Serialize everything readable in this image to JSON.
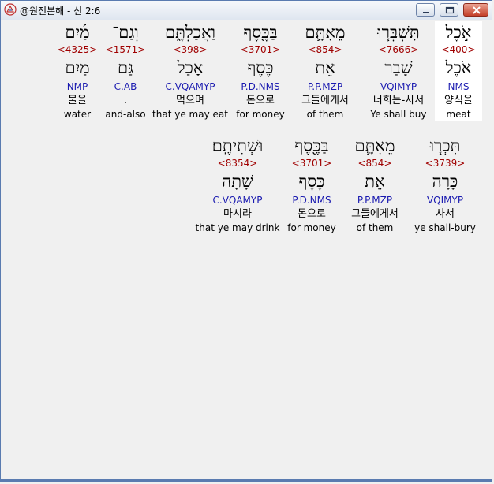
{
  "window": {
    "title": "@원전본해 - 신 2:6",
    "min_label": "minimize",
    "max_label": "maximize",
    "close_label": "close"
  },
  "rows": [
    {
      "words": [
        {
          "heb": "אֹ֣כֶל",
          "strong": "<400>",
          "lemma": "אֹכֶל",
          "morph": "NMS",
          "kor": "양식을",
          "eng": "meat",
          "highlight": true
        },
        {
          "heb": "תִּשְׁבְּר֧וּ",
          "strong": "<7666>",
          "lemma": "שָׁבַר",
          "morph": "VQIMYP",
          "kor": "너희는-사서",
          "eng": "Ye shall buy"
        },
        {
          "heb": "מֵאִתָּ֛ם",
          "strong": "<854>",
          "lemma": "אֵת",
          "morph": "P.P.MZP",
          "kor": "그들에게서",
          "eng": "of them"
        },
        {
          "heb": "בַּכֶּ֖סֶף",
          "strong": "<3701>",
          "lemma": "כֶּסֶף",
          "morph": "P.D.NMS",
          "kor": "돈으로",
          "eng": "for money"
        },
        {
          "heb": "וַאֲכַלְתֶּ֑ם",
          "strong": "<398>",
          "lemma": "אָכַל",
          "morph": "C.VQAMYP",
          "kor": "먹으며",
          "eng": "that ye may eat"
        },
        {
          "heb": "וְגַם־",
          "strong": "<1571>",
          "lemma": "גַּם",
          "morph": "C.AB",
          "kor": ".",
          "eng": "and-also"
        },
        {
          "heb": "מַ֜יִם",
          "strong": "<4325>",
          "lemma": "מַיִם",
          "morph": "NMP",
          "kor": "물을",
          "eng": "water"
        }
      ]
    },
    {
      "words": [
        {
          "heb": "תִּכְר֧וּ",
          "strong": "<3739>",
          "lemma": "כָּרָה",
          "morph": "VQIMYP",
          "kor": "사서",
          "eng": "ye shall-bury"
        },
        {
          "heb": "מֵאִתָּ֛ם",
          "strong": "<854>",
          "lemma": "אֵת",
          "morph": "P.P.MZP",
          "kor": "그들에게서",
          "eng": "of them"
        },
        {
          "heb": "בַּכֶּ֖סֶף",
          "strong": "<3701>",
          "lemma": "כֶּסֶף",
          "morph": "P.D.NMS",
          "kor": "돈으로",
          "eng": "for money"
        },
        {
          "heb": "וּשְׁתִיתֶֽם׃",
          "strong": "<8354>",
          "lemma": "שָׁתָה",
          "morph": "C.VQAMYP",
          "kor": "마시라",
          "eng": "that ye may drink"
        }
      ]
    }
  ],
  "colors": {
    "strong": "#a00000",
    "morph": "#1a1ab0",
    "highlight": "#ffffff"
  }
}
